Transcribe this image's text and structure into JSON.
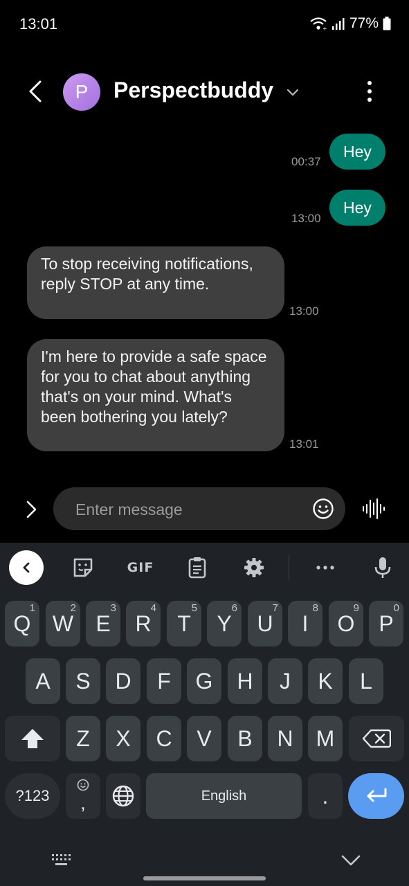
{
  "status_bar": {
    "time": "13:01",
    "battery": "77%",
    "icons": [
      "wifi-icon",
      "signal-icon",
      "battery-icon"
    ]
  },
  "header": {
    "avatar_letter": "P",
    "contact_name": "Perspectbuddy"
  },
  "messages": [
    {
      "direction": "out",
      "text": "Hey",
      "time": "00:37"
    },
    {
      "direction": "out",
      "text": "Hey",
      "time": "13:00"
    },
    {
      "direction": "in",
      "text": "To stop receiving notifications, reply STOP at any time.",
      "time": "13:00"
    },
    {
      "direction": "in",
      "text": "I'm here to provide a safe space for you to chat about anything that's on your mind. What's been bothering you lately?",
      "time": "13:01"
    }
  ],
  "composer": {
    "placeholder": "Enter message"
  },
  "keyboard": {
    "toolbar": {
      "gif_label": "GIF"
    },
    "row1": [
      {
        "label": "Q",
        "hint": "1"
      },
      {
        "label": "W",
        "hint": "2"
      },
      {
        "label": "E",
        "hint": "3"
      },
      {
        "label": "R",
        "hint": "4"
      },
      {
        "label": "T",
        "hint": "5"
      },
      {
        "label": "Y",
        "hint": "6"
      },
      {
        "label": "U",
        "hint": "7"
      },
      {
        "label": "I",
        "hint": "8"
      },
      {
        "label": "O",
        "hint": "9"
      },
      {
        "label": "P",
        "hint": "0"
      }
    ],
    "row2": [
      "A",
      "S",
      "D",
      "F",
      "G",
      "H",
      "J",
      "K",
      "L"
    ],
    "row3": [
      "Z",
      "X",
      "C",
      "V",
      "B",
      "N",
      "M"
    ],
    "symbols_label": "?123",
    "comma_label": ",",
    "space_label": "English",
    "period_label": "."
  },
  "colors": {
    "outgoing_bubble": "#007f6c",
    "incoming_bubble": "#3f3f3f",
    "enter_key": "#5b9cf3",
    "keyboard_bg": "#1f2327"
  }
}
